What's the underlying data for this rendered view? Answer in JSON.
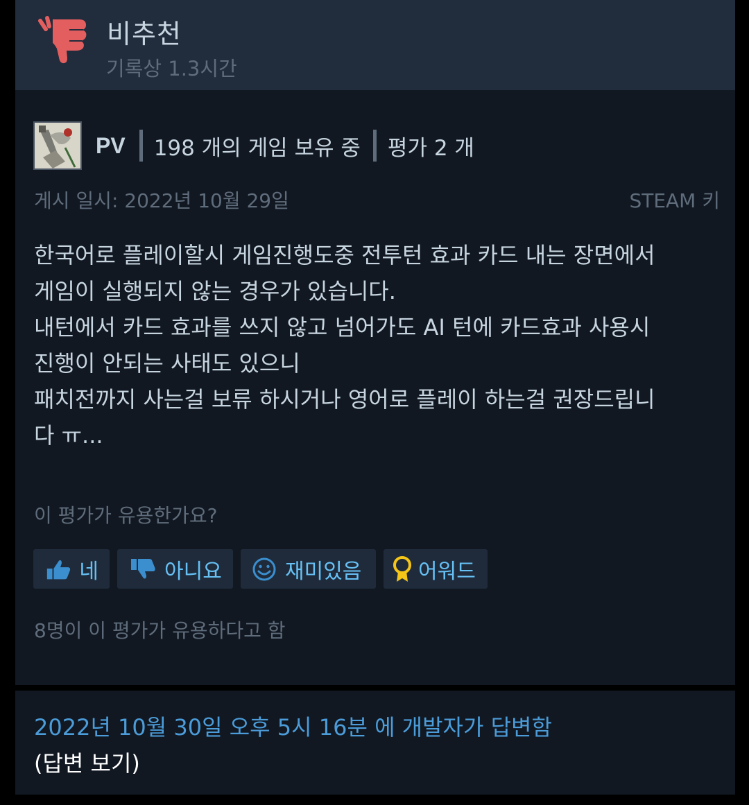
{
  "header": {
    "verdict": "비추천",
    "hours": "기록상 1.3시간",
    "verdict_icon": "thumbs-down-icon",
    "verdict_color": "#e35f5f"
  },
  "author": {
    "name": "PV",
    "games_owned": "198 개의 게임 보유 중",
    "reviews": "평가 2 개"
  },
  "meta": {
    "posted": "게시 일시: 2022년 10월 29일",
    "source": "STEAM 키"
  },
  "review": {
    "text": "한국어로 플레이할시 게임진행도중 전투턴 효과 카드 내는 장면에서\n게임이 실행되지 않는 경우가 있습니다.\n내턴에서 카드 효과를 쓰지 않고 넘어가도 AI 턴에 카드효과 사용시\n진행이 안되는 사태도 있으니\n패치전까지 사는걸 보류 하시거나 영어로 플레이 하는걸 권장드립니\n다 ㅠ..."
  },
  "feedback": {
    "question": "이 평가가 유용한가요?",
    "buttons": {
      "yes": "네",
      "no": "아니요",
      "funny": "재미있음",
      "award": "어워드"
    },
    "helpful_count": "8명이 이 평가가 유용하다고 함"
  },
  "developer_response": {
    "link": "2022년 10월 30일 오후 5시 16분 에 개발자가 답변함",
    "view": "(답변 보기)"
  },
  "colors": {
    "accent": "#67c1f5",
    "link": "#4b9cd9",
    "award": "#f5c518"
  }
}
